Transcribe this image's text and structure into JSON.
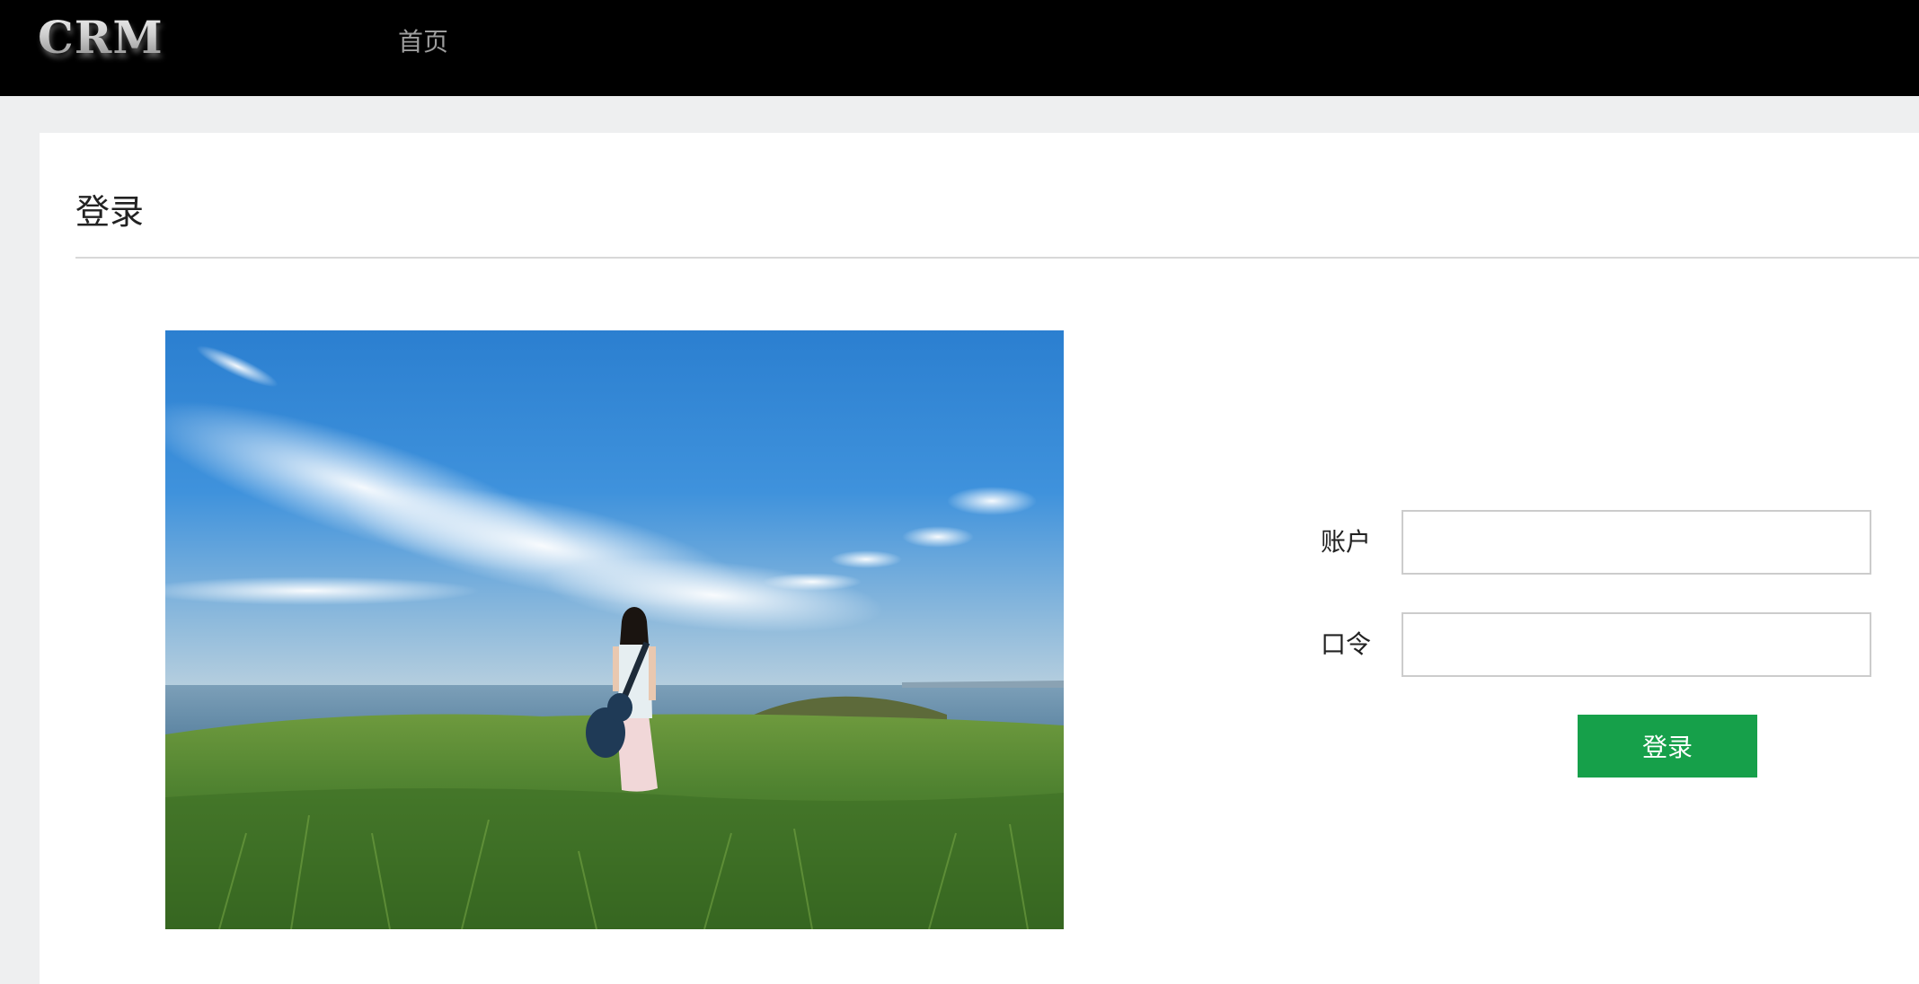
{
  "header": {
    "logo_text": "CRM",
    "nav_home_label": "首页"
  },
  "main": {
    "title": "登录",
    "image": {
      "subject": "girl-with-guitar-on-grassy-hill-by-sea-photo"
    },
    "form": {
      "account_label": "账户",
      "account_value": "",
      "password_label": "口令",
      "password_value": "",
      "submit_label": "登录"
    }
  },
  "colors": {
    "topbar_bg": "#000000",
    "page_bg": "#eeeff0",
    "panel_bg": "#ffffff",
    "nav_text": "#9d9d9d",
    "button_bg": "#16a04a",
    "button_text": "#ffffff",
    "input_border": "#cccccc"
  }
}
